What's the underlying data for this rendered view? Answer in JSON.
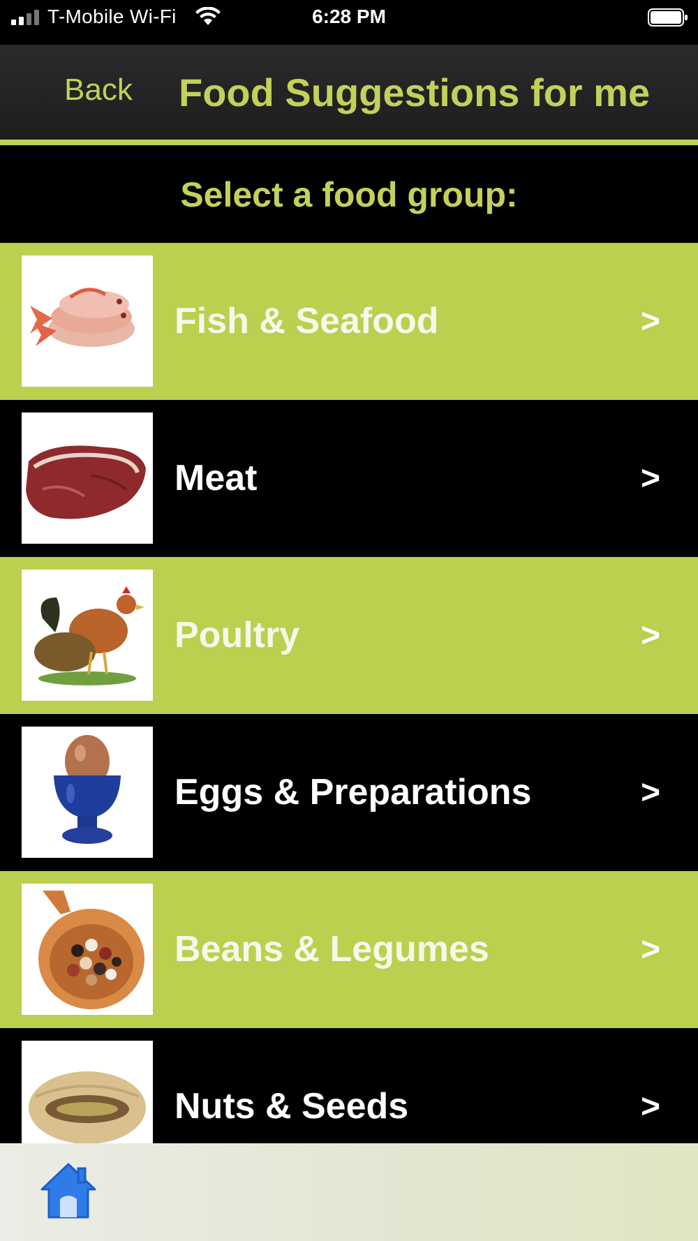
{
  "status_bar": {
    "carrier": "T-Mobile Wi-Fi",
    "time": "6:28 PM"
  },
  "nav": {
    "back_label": "Back",
    "title": "Food Suggestions for me"
  },
  "section": {
    "heading": "Select a food group:"
  },
  "food_groups": [
    {
      "label": "Fish & Seafood",
      "icon": "fish-icon"
    },
    {
      "label": "Meat",
      "icon": "steak-icon"
    },
    {
      "label": "Poultry",
      "icon": "chicken-icon"
    },
    {
      "label": "Eggs & Preparations",
      "icon": "egg-icon"
    },
    {
      "label": "Beans & Legumes",
      "icon": "beans-icon"
    },
    {
      "label": "Nuts & Seeds",
      "icon": "nut-icon"
    }
  ],
  "chevron": ">",
  "tab_bar": {
    "icon": "home-icon"
  },
  "colors": {
    "accent": "#c3d15a",
    "row_green": "#bccf4e",
    "row_black": "#000000",
    "home_blue": "#2f7be8"
  }
}
